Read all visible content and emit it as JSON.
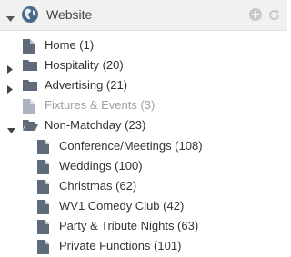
{
  "header": {
    "title": "Website",
    "icon": "globe-icon",
    "actions": [
      "add-icon",
      "refresh-icon"
    ],
    "collapse_icon": "caret-down-icon"
  },
  "tree": [
    {
      "label": "Home (1)",
      "icon": "file-icon",
      "level": 0,
      "state": "leaf",
      "disabled": false
    },
    {
      "label": "Hospitality (20)",
      "icon": "folder-icon",
      "level": 0,
      "state": "collapsed",
      "disabled": false
    },
    {
      "label": "Advertising (21)",
      "icon": "folder-icon",
      "level": 0,
      "state": "collapsed",
      "disabled": false
    },
    {
      "label": "Fixtures & Events (3)",
      "icon": "file-icon",
      "level": 0,
      "state": "leaf",
      "disabled": true
    },
    {
      "label": "Non-Matchday (23)",
      "icon": "folder-open-icon",
      "level": 0,
      "state": "expanded",
      "disabled": false
    },
    {
      "label": "Conference/Meetings (108)",
      "icon": "file-icon",
      "level": 1,
      "state": "leaf",
      "disabled": false
    },
    {
      "label": "Weddings (100)",
      "icon": "file-icon",
      "level": 1,
      "state": "leaf",
      "disabled": false
    },
    {
      "label": "Christmas (62)",
      "icon": "file-icon",
      "level": 1,
      "state": "leaf",
      "disabled": false
    },
    {
      "label": "WV1 Comedy Club (42)",
      "icon": "file-icon",
      "level": 1,
      "state": "leaf",
      "disabled": false
    },
    {
      "label": "Party & Tribute Nights (63)",
      "icon": "file-icon",
      "level": 1,
      "state": "leaf",
      "disabled": false
    },
    {
      "label": "Private Functions (101)",
      "icon": "file-icon",
      "level": 1,
      "state": "leaf",
      "disabled": false
    }
  ],
  "colors": {
    "header_bg": "#f1f1f1",
    "icon": "#5f6b7a",
    "icon_disabled": "#aab3bf",
    "globe": "#4a6a8c",
    "text": "#333333",
    "text_disabled": "#9aa0a6",
    "action_icon": "#c8c8c8"
  }
}
